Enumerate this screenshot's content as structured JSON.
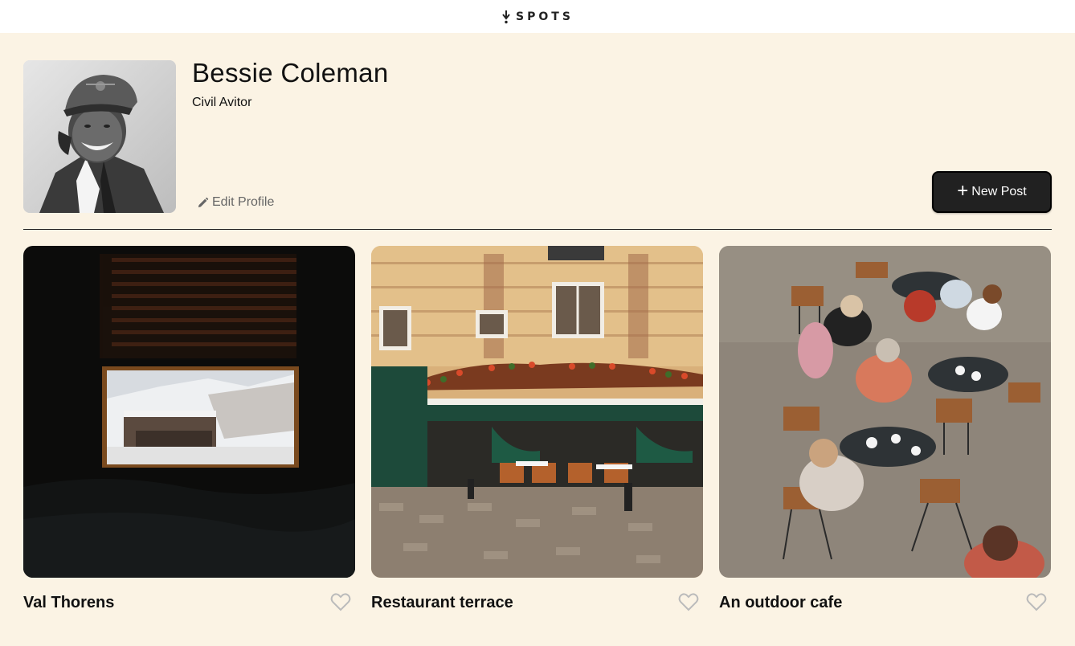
{
  "header": {
    "logo_text": "SPOTS"
  },
  "profile": {
    "name": "Bessie Coleman",
    "description": "Civil Avitor",
    "edit_label": "Edit Profile",
    "new_post_label": "New Post"
  },
  "cards": [
    {
      "title": "Val Thorens",
      "liked": false
    },
    {
      "title": "Restaurant terrace",
      "liked": false
    },
    {
      "title": "An outdoor cafe",
      "liked": false
    }
  ],
  "colors": {
    "background": "#fbf3e4",
    "button": "#212121",
    "heart": "#bbbbbb"
  }
}
